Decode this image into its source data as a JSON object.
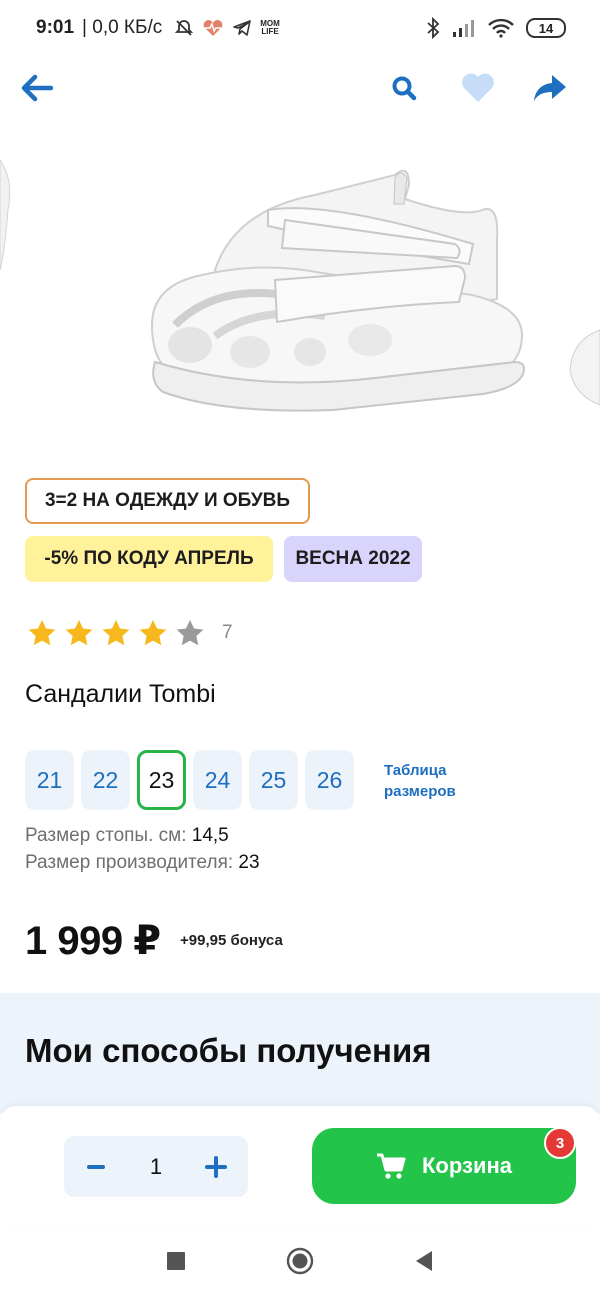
{
  "status_bar": {
    "time": "9:01",
    "network_speed": "| 0,0 КБ/с",
    "momlife_line1": "MOM",
    "momlife_line2": "LIFE",
    "battery": "14"
  },
  "nav": {
    "icons": [
      "back-arrow-icon",
      "search-icon",
      "heart-icon",
      "share-icon"
    ],
    "accent_color": "#1e6fc0"
  },
  "badges": {
    "promo": "3=2 НА ОДЕЖДУ И ОБУВЬ",
    "code": "-5% ПО КОДУ АПРЕЛЬ",
    "season": "ВЕСНА 2022"
  },
  "rating": {
    "stars": 4,
    "max": 5,
    "count": "7"
  },
  "product": {
    "title": "Сандалии Tombi",
    "price": "1 999 ₽",
    "bonus": "+99,95 бонуса"
  },
  "sizes": {
    "options": [
      "21",
      "22",
      "23",
      "24",
      "25",
      "26"
    ],
    "selected": "23",
    "table_link_line1": "Таблица",
    "table_link_line2": "размеров",
    "foot_label": "Размер стопы. см: ",
    "foot_value": "14,5",
    "maker_label": "Размер производителя: ",
    "maker_value": "23"
  },
  "delivery": {
    "title": "Мои способы получения"
  },
  "cart": {
    "quantity": "1",
    "button_label": "Корзина",
    "badge_count": "3",
    "button_color": "#23c44a"
  }
}
